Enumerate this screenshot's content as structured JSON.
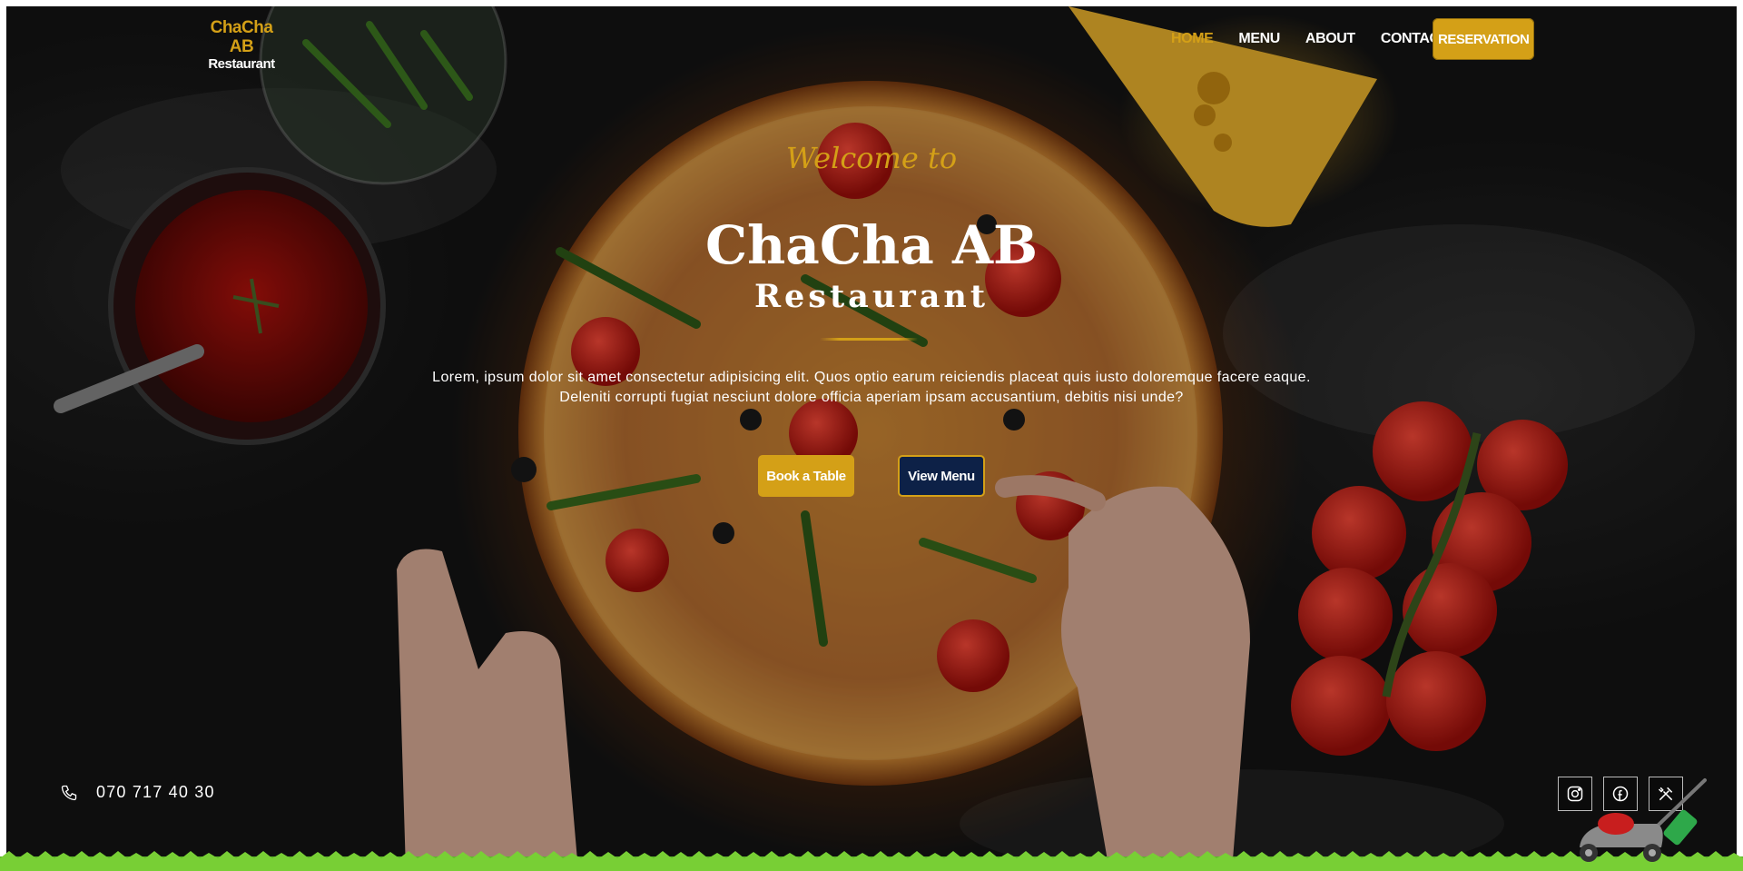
{
  "brand": {
    "name": "ChaCha AB",
    "subtitle": "Restaurant"
  },
  "nav": {
    "items": [
      "HOME",
      "MENU",
      "ABOUT",
      "CONTACT"
    ],
    "active": "HOME",
    "reservation_label": "RESERVATION"
  },
  "hero": {
    "welcome": "Welcome to",
    "title": "ChaCha AB",
    "subtitle": "Restaurant",
    "description": "Lorem, ipsum dolor sit amet consectetur adipisicing elit. Quos optio earum reiciendis placeat quis iusto doloremque facere eaque. Deleniti corrupti fugiat nesciunt dolore officia aperiam ipsam accusantium, debitis nisi unde?",
    "book_label": "Book a Table",
    "menu_label": "View Menu"
  },
  "contact": {
    "phone": "070 717 40 30",
    "icon": "phone-icon"
  },
  "social": [
    {
      "icon": "instagram-icon"
    },
    {
      "icon": "facebook-icon"
    },
    {
      "icon": "utensils-icon"
    }
  ],
  "colors": {
    "accent": "#d4a017",
    "navy": "#0d2147",
    "text": "#ffffff",
    "background": "#141414"
  }
}
